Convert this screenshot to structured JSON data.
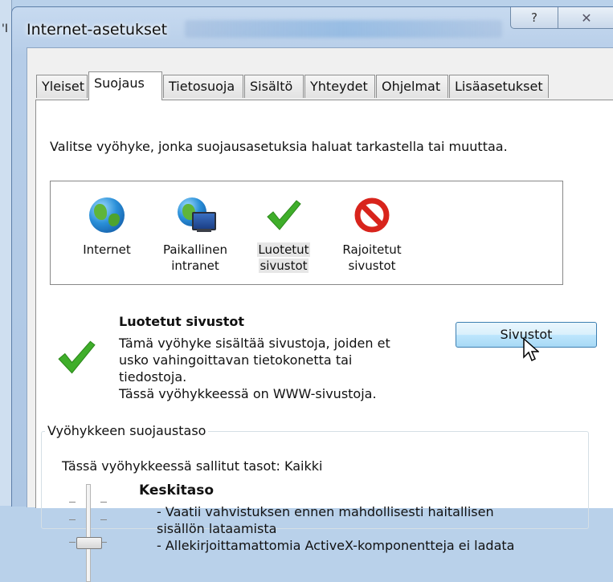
{
  "background_window": {
    "title_fragment": "'I"
  },
  "window": {
    "title": "Internet-asetukset",
    "help_glyph": "?",
    "close_glyph": "✕"
  },
  "tabs": [
    {
      "label": "Yleiset"
    },
    {
      "label": "Suojaus",
      "active": true
    },
    {
      "label": "Tietosuoja"
    },
    {
      "label": "Sisältö"
    },
    {
      "label": "Yhteydet"
    },
    {
      "label": "Ohjelmat"
    },
    {
      "label": "Lisäasetukset"
    }
  ],
  "security": {
    "instruction": "Valitse vyöhyke, jonka suojausasetuksia haluat tarkastella tai muuttaa.",
    "zones": [
      {
        "line1": "Internet",
        "line2": "",
        "icon": "globe-icon"
      },
      {
        "line1": "Paikallinen",
        "line2": "intranet",
        "icon": "intranet-icon"
      },
      {
        "line1": "Luotetut",
        "line2": "sivustot",
        "icon": "checkmark-icon",
        "selected": true
      },
      {
        "line1": "Rajoitetut",
        "line2": "sivustot",
        "icon": "restricted-icon"
      }
    ],
    "selected_zone": {
      "title": "Luotetut sivustot",
      "description_lines": [
        "Tämä vyöhyke sisältää sivustoja, joiden et",
        "usko vahingoittavan tietokonetta tai",
        "tiedostoja.",
        "Tässä vyöhykkeessä on WWW-sivustoja."
      ],
      "sites_button": "Sivustot"
    },
    "level_group": {
      "label": "Vyöhykkeen suojaustaso",
      "allowed_levels": "Tässä vyöhykkeessä sallitut tasot: Kaikki",
      "level_name": "Keskitaso",
      "bullets": [
        "- Vaatii vahvistuksen ennen mahdollisesti haitallisen",
        "sisällön lataamista",
        "- Allekirjoittamattomia ActiveX-komponentteja ei ladata"
      ]
    }
  },
  "colors": {
    "titlebar": "#b6cde8",
    "dialog_bg": "#f0f0f0",
    "panel_bg": "#ffffff",
    "check_green": "#3fae2a",
    "restricted_red": "#d8241c",
    "button_border": "#3c7fb1"
  }
}
